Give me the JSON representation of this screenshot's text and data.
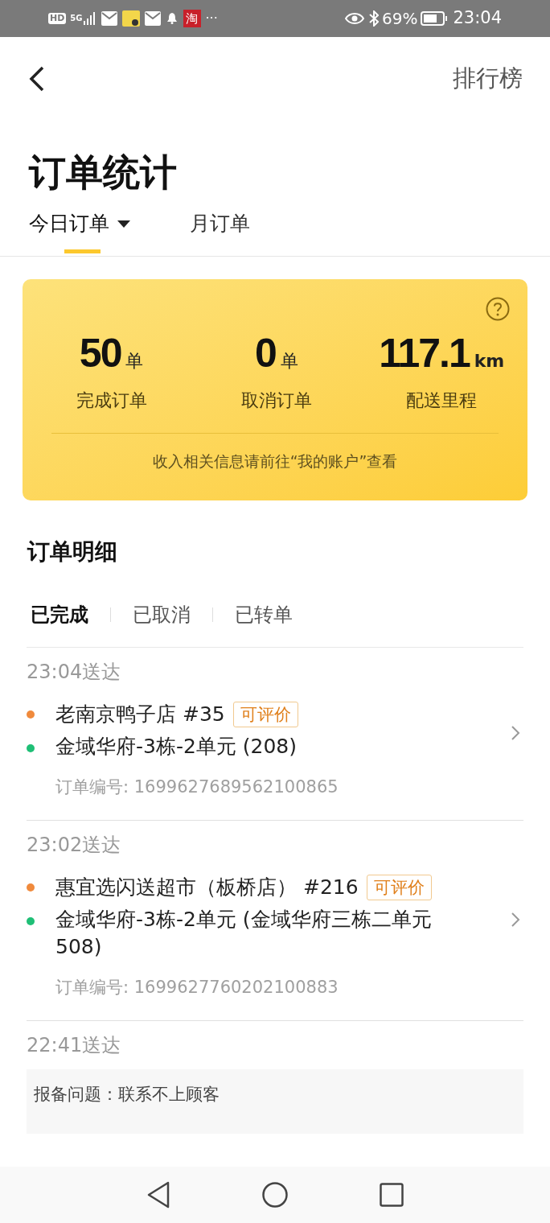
{
  "status_bar": {
    "badges": [
      "HD",
      "5G"
    ],
    "app_icon": "淘",
    "more": "···",
    "battery": "69%",
    "time": "23:04"
  },
  "header": {
    "right_link": "排行榜"
  },
  "title": "订单统计",
  "tabs": [
    {
      "label": "今日订单",
      "selected": true,
      "dropdown": true
    },
    {
      "label": "月订单",
      "selected": false,
      "dropdown": false
    }
  ],
  "summary": {
    "stats": [
      {
        "value": "50",
        "unit": "单",
        "label": "完成订单"
      },
      {
        "value": "0",
        "unit": "单",
        "label": "取消订单"
      },
      {
        "value": "117.1",
        "unit": "km",
        "label": "配送里程"
      }
    ],
    "note": "收入相关信息请前往“我的账户”查看"
  },
  "detail_title": "订单明细",
  "filter_tabs": [
    {
      "label": "已完成",
      "selected": true
    },
    {
      "label": "已取消",
      "selected": false
    },
    {
      "label": "已转单",
      "selected": false
    }
  ],
  "orders": [
    {
      "kind": "delivery",
      "time": "23:04送达",
      "store": "老南京鸭子店 #35",
      "badge": "可评价",
      "address": "金域华府-3栋-2单元 (208)",
      "order_no": "订单编号: 1699627689562100865"
    },
    {
      "kind": "delivery",
      "time": "23:02送达",
      "store": "惠宜选闪送超市（板桥店） #216",
      "badge": "可评价",
      "address": "金域华府-3栋-2单元 (金域华府三栋二单元 508)",
      "order_no": "订单编号: 1699627760202100883"
    },
    {
      "kind": "issue",
      "time": "22:41送达",
      "note": "报备问题：联系不上顾客"
    }
  ]
}
